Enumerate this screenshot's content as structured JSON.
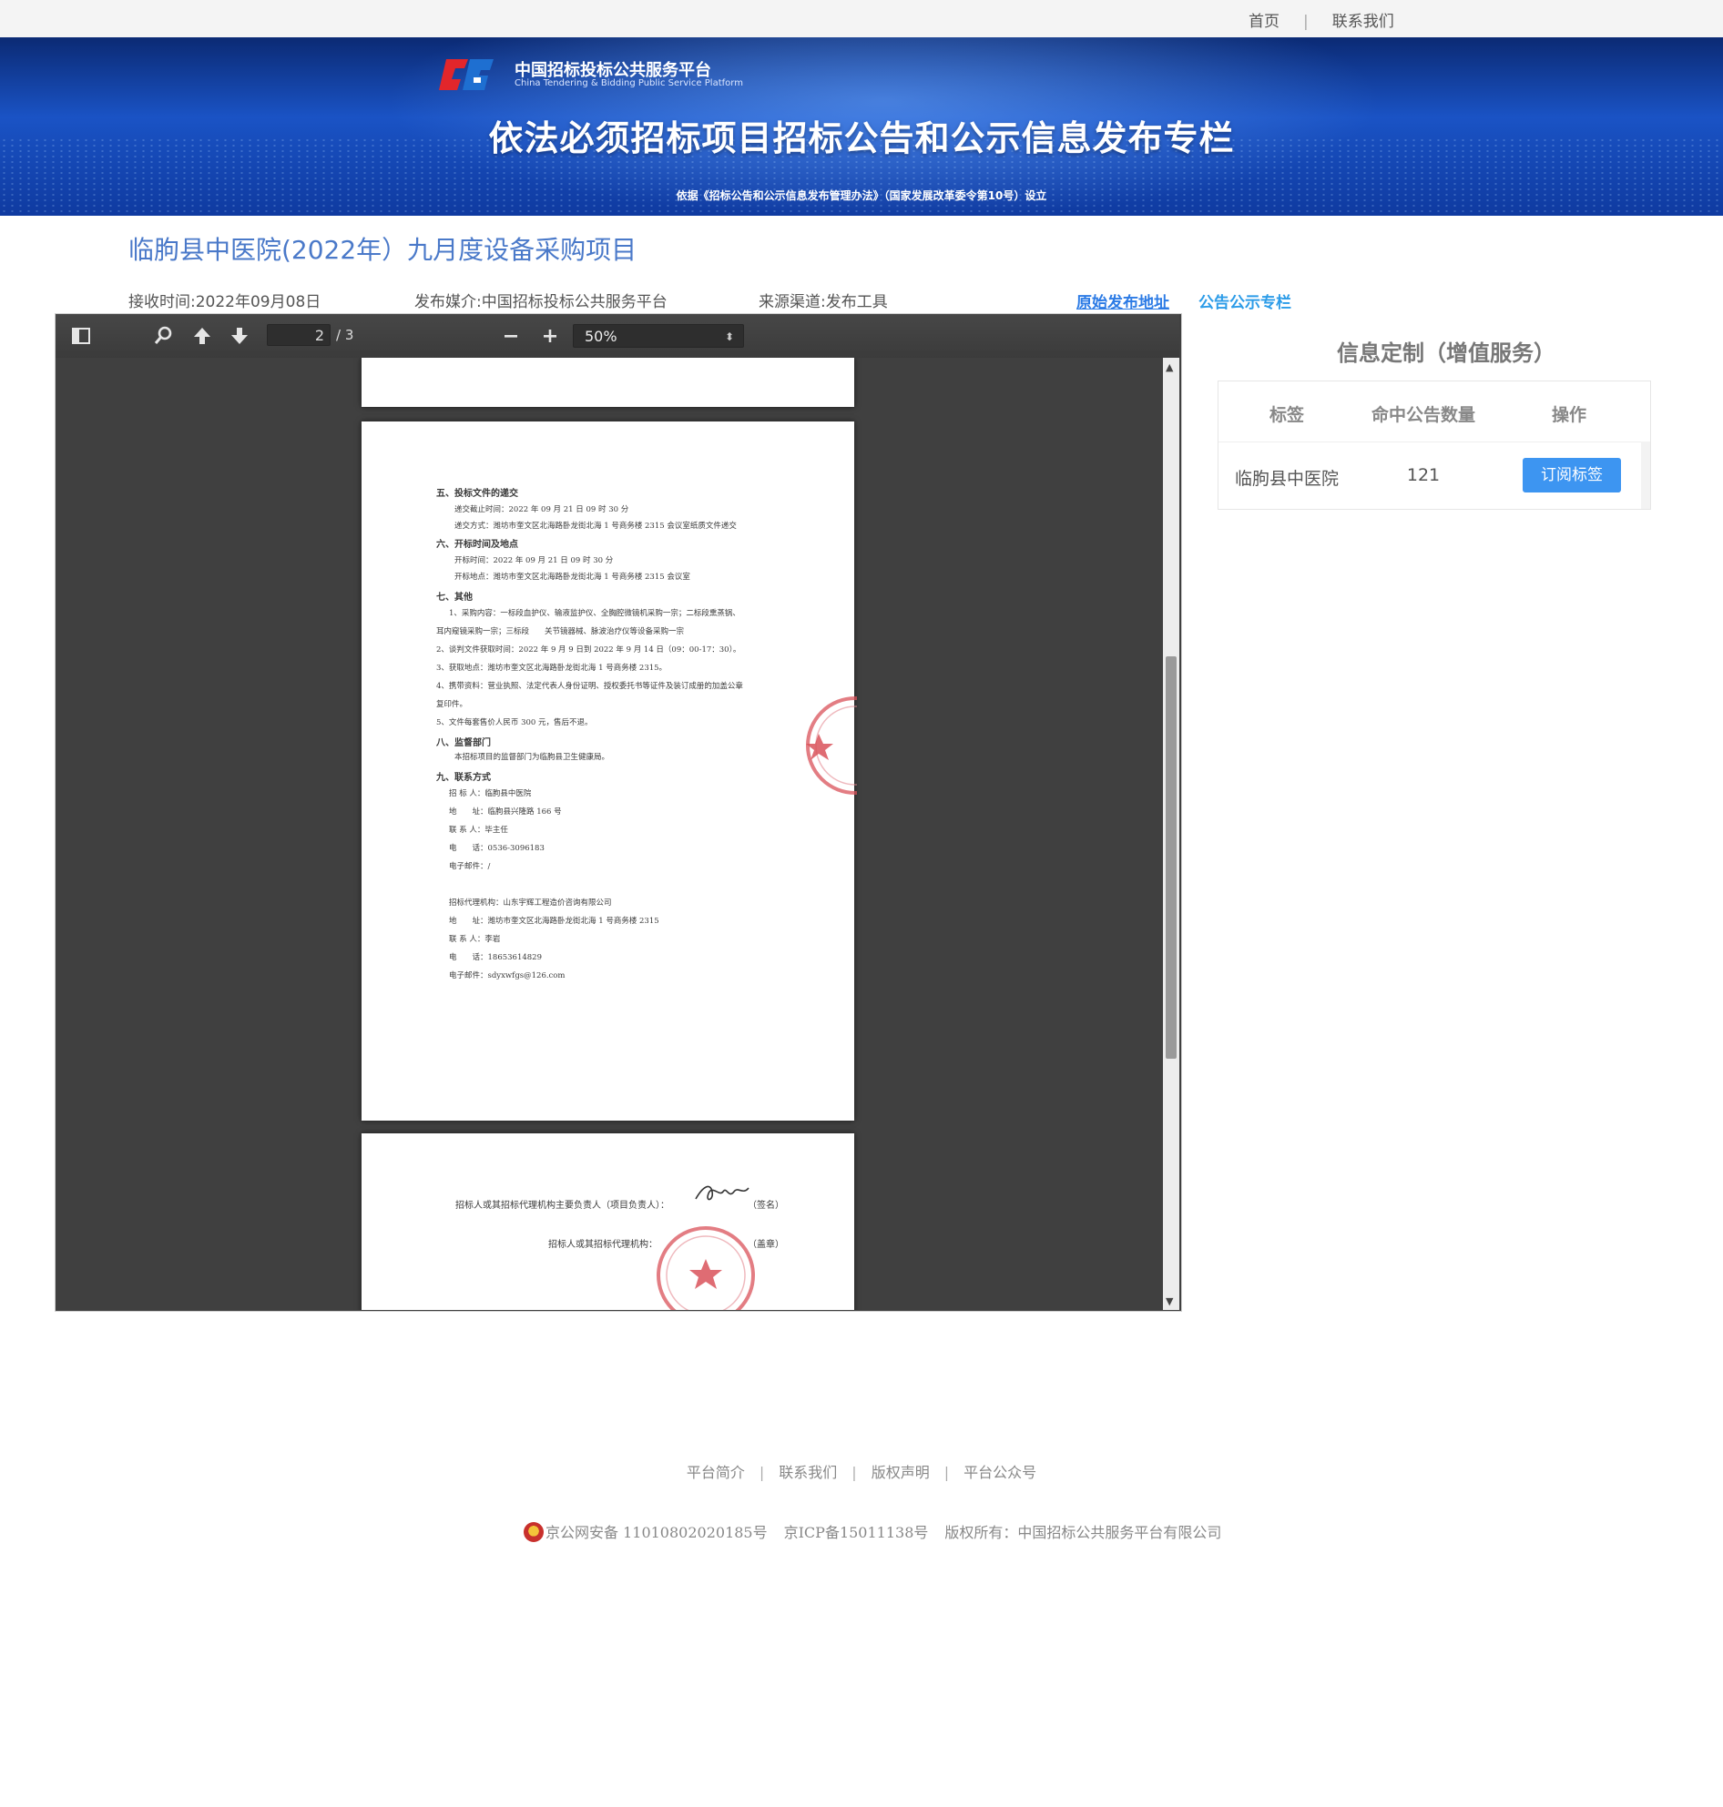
{
  "topbar": {
    "home": "首页",
    "separator": "|",
    "contact": "联系我们"
  },
  "banner": {
    "brand_cn": "中国招标投标公共服务平台",
    "brand_en": "China Tendering & Bidding Public Service Platform",
    "headline": "依法必须招标项目招标公告和公示信息发布专栏",
    "basis": "依据《招标公告和公示信息发布管理办法》（国家发展改革委令第10号）设立"
  },
  "notice": {
    "title": "临朐县中医院(2022年）九月度设备采购项目",
    "received": "接收时间:2022年09月08日",
    "media": "发布媒介:中国招标投标公共服务平台",
    "source": "来源渠道:发布工具",
    "link_original": "原始发布地址",
    "link_column": "公告公示专栏"
  },
  "viewer": {
    "page_current": "2",
    "page_total": "/ 3",
    "zoom": "50%",
    "page2_lines": [
      "五、投标文件的递交",
      "递交截止时间：2022 年 09 月 21 日 09 时 30 分",
      "递交方式：潍坊市奎文区北海路卧龙街北海 1 号商务楼 2315 会议室纸质文件递交",
      "六、开标时间及地点",
      "开标时间：2022 年 09 月 21 日 09 时 30 分",
      "开标地点：潍坊市奎文区北海路卧龙街北海 1 号商务楼 2315 会议室",
      "七、其他",
      "1、采购内容：一标段血护仪、输液监护仪、全胸腔微镜机采购一宗；二标段熏蒸锅、",
      "耳内窥镜采购一宗；三标段　　关节镜器械、脉波治疗仪等设备采购一宗",
      "2、谈判文件获取时间：2022 年 9 月 9 日到 2022 年 9 月 14 日（09：00-17：30）。",
      "3、获取地点：潍坊市奎文区北海路卧龙街北海 1 号商务楼 2315。",
      "4、携带资料：营业执照、法定代表人身份证明、授权委托书等证件及装订成册的加盖公章",
      "复印件。",
      "5、文件每套售价人民币 300 元，售后不退。",
      "八、监督部门",
      "本招标项目的监督部门为临朐县卫生健康局。",
      "九、联系方式",
      "招 标 人：临朐县中医院",
      "地　　址：临朐县兴隆路 166 号",
      "联 系 人：毕主任",
      "电　　话：0536-3096183",
      "电子邮件：/",
      "招标代理机构：山东宇辉工程造价咨询有限公司",
      "地　　址：潍坊市奎文区北海路卧龙街北海 1 号商务楼 2315",
      "联 系 人：李岩",
      "电　　话：18653614829",
      "电子邮件：sdyxwfgs@126.com"
    ],
    "page3_lines": [
      "招标人或其招标代理机构主要负责人（项目负责人）：",
      "（签名）",
      "招标人或其招标代理机构：",
      "（盖章）"
    ]
  },
  "subscription": {
    "title": "信息定制（增值服务）",
    "headers": [
      "标签",
      "命中公告数量",
      "操作"
    ],
    "row": {
      "tag": "临朐县中医院",
      "count": "121",
      "button": "订阅标签"
    }
  },
  "footer": {
    "links": [
      "平台简介",
      "联系我们",
      "版权声明",
      "平台公众号"
    ],
    "separator": "|",
    "police": "京公网安备 11010802020185号",
    "icp": "京ICP备15011138号",
    "copyright": "版权所有：中国招标公共服务平台有限公司"
  },
  "colors": {
    "title_blue": "#4a79c9",
    "link_blue": "#2c7be5",
    "button_blue": "#3d95f1",
    "viewer_bg": "#404040"
  }
}
